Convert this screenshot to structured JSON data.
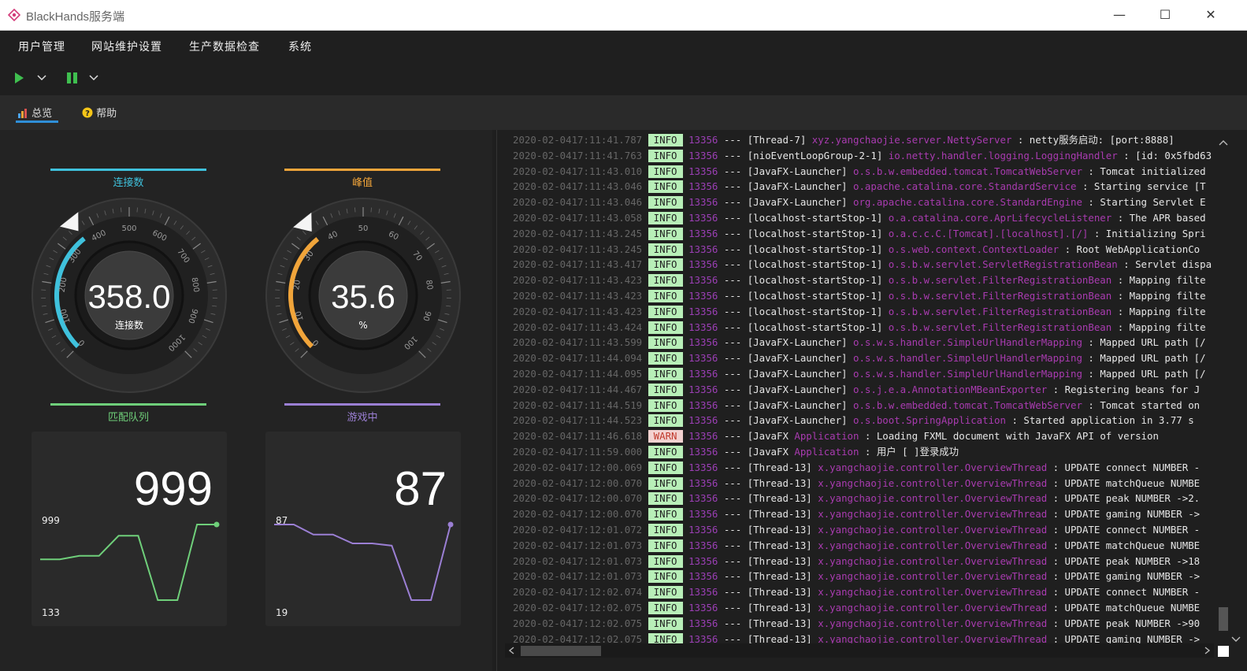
{
  "window": {
    "title": "BlackHands服务端",
    "min": "—",
    "max": "☐",
    "close": "✕"
  },
  "menu": [
    "用户管理",
    "网站维护设置",
    "生产数据检查",
    "系统"
  ],
  "tabs": [
    {
      "label": "总览",
      "icon": "chart-icon"
    },
    {
      "label": "帮助",
      "icon": "help-icon"
    }
  ],
  "colors": {
    "connect": "#3fc1dc",
    "peak": "#f0a43a",
    "match": "#6fcf7a",
    "gaming": "#9b7fd4",
    "accent": "#2f8fd8"
  },
  "gauges": [
    {
      "title": "连接数",
      "value": "358.0",
      "unit": "连接数",
      "min": 0,
      "max": 1000,
      "level": 358,
      "ticks": [
        "0",
        "100",
        "200",
        "300",
        "400",
        "500",
        "600",
        "700",
        "800",
        "900",
        "1000"
      ],
      "color": "#3fc1dc"
    },
    {
      "title": "峰值",
      "value": "35.6",
      "unit": "%",
      "min": 0,
      "max": 100,
      "level": 35.6,
      "ticks": [
        "0",
        "10",
        "20",
        "30",
        "40",
        "50",
        "60",
        "70",
        "80",
        "90",
        "100"
      ],
      "color": "#f0a43a"
    }
  ],
  "cards": [
    {
      "title": "匹配队列",
      "value": "999",
      "max_label": "999",
      "min_label": "133",
      "color": "#6fcf7a",
      "series": [
        600,
        600,
        640,
        640,
        870,
        870,
        133,
        133,
        999,
        999
      ]
    },
    {
      "title": "游戏中",
      "value": "87",
      "max_label": "87",
      "min_label": "19",
      "color": "#9b7fd4",
      "series": [
        87,
        87,
        78,
        78,
        70,
        70,
        68,
        19,
        19,
        87
      ]
    }
  ],
  "log": [
    {
      "ts": "2020-02-0417:11:41.787",
      "lvl": "INFO",
      "pid": "13356",
      "thread": "[Thread-7]",
      "logger": "xyz.yangchaojie.server.NettyServer",
      "msg": ": netty服务启动: [port:8888]"
    },
    {
      "ts": "2020-02-0417:11:41.763",
      "lvl": "INFO",
      "pid": "13356",
      "thread": "[nioEventLoopGroup-2-1]",
      "logger": "io.netty.handler.logging.LoggingHandler",
      "msg": ": [id: 0x5fbd63"
    },
    {
      "ts": "2020-02-0417:11:43.010",
      "lvl": "INFO",
      "pid": "13356",
      "thread": "[JavaFX-Launcher]",
      "logger": "o.s.b.w.embedded.tomcat.TomcatWebServer",
      "msg": ": Tomcat initialized"
    },
    {
      "ts": "2020-02-0417:11:43.046",
      "lvl": "INFO",
      "pid": "13356",
      "thread": "[JavaFX-Launcher]",
      "logger": "o.apache.catalina.core.StandardService",
      "msg": ": Starting service [T"
    },
    {
      "ts": "2020-02-0417:11:43.046",
      "lvl": "INFO",
      "pid": "13356",
      "thread": "[JavaFX-Launcher]",
      "logger": "org.apache.catalina.core.StandardEngine",
      "msg": ": Starting Servlet E"
    },
    {
      "ts": "2020-02-0417:11:43.058",
      "lvl": "INFO",
      "pid": "13356",
      "thread": "[localhost-startStop-1]",
      "logger": "o.a.catalina.core.AprLifecycleListener",
      "msg": ": The APR based"
    },
    {
      "ts": "2020-02-0417:11:43.245",
      "lvl": "INFO",
      "pid": "13356",
      "thread": "[localhost-startStop-1]",
      "logger": "o.a.c.c.C.[Tomcat].[localhost].[/]",
      "msg": ": Initializing Spri"
    },
    {
      "ts": "2020-02-0417:11:43.245",
      "lvl": "INFO",
      "pid": "13356",
      "thread": "[localhost-startStop-1]",
      "logger": "o.s.web.context.ContextLoader",
      "msg": ": Root WebApplicationCo"
    },
    {
      "ts": "2020-02-0417:11:43.417",
      "lvl": "INFO",
      "pid": "13356",
      "thread": "[localhost-startStop-1]",
      "logger": "o.s.b.w.servlet.ServletRegistrationBean",
      "msg": ": Servlet dispa"
    },
    {
      "ts": "2020-02-0417:11:43.423",
      "lvl": "INFO",
      "pid": "13356",
      "thread": "[localhost-startStop-1]",
      "logger": "o.s.b.w.servlet.FilterRegistrationBean",
      "msg": ": Mapping filte"
    },
    {
      "ts": "2020-02-0417:11:43.423",
      "lvl": "INFO",
      "pid": "13356",
      "thread": "[localhost-startStop-1]",
      "logger": "o.s.b.w.servlet.FilterRegistrationBean",
      "msg": ": Mapping filte"
    },
    {
      "ts": "2020-02-0417:11:43.423",
      "lvl": "INFO",
      "pid": "13356",
      "thread": "[localhost-startStop-1]",
      "logger": "o.s.b.w.servlet.FilterRegistrationBean",
      "msg": ": Mapping filte"
    },
    {
      "ts": "2020-02-0417:11:43.424",
      "lvl": "INFO",
      "pid": "13356",
      "thread": "[localhost-startStop-1]",
      "logger": "o.s.b.w.servlet.FilterRegistrationBean",
      "msg": ": Mapping filte"
    },
    {
      "ts": "2020-02-0417:11:43.599",
      "lvl": "INFO",
      "pid": "13356",
      "thread": "[JavaFX-Launcher]",
      "logger": "o.s.w.s.handler.SimpleUrlHandlerMapping",
      "msg": ": Mapped URL path [/"
    },
    {
      "ts": "2020-02-0417:11:44.094",
      "lvl": "INFO",
      "pid": "13356",
      "thread": "[JavaFX-Launcher]",
      "logger": "o.s.w.s.handler.SimpleUrlHandlerMapping",
      "msg": ": Mapped URL path [/"
    },
    {
      "ts": "2020-02-0417:11:44.095",
      "lvl": "INFO",
      "pid": "13356",
      "thread": "[JavaFX-Launcher]",
      "logger": "o.s.w.s.handler.SimpleUrlHandlerMapping",
      "msg": ": Mapped URL path [/"
    },
    {
      "ts": "2020-02-0417:11:44.467",
      "lvl": "INFO",
      "pid": "13356",
      "thread": "[JavaFX-Launcher]",
      "logger": "o.s.j.e.a.AnnotationMBeanExporter",
      "msg": ": Registering beans for J"
    },
    {
      "ts": "2020-02-0417:11:44.519",
      "lvl": "INFO",
      "pid": "13356",
      "thread": "[JavaFX-Launcher]",
      "logger": "o.s.b.w.embedded.tomcat.TomcatWebServer",
      "msg": ": Tomcat started on"
    },
    {
      "ts": "2020-02-0417:11:44.523",
      "lvl": "INFO",
      "pid": "13356",
      "thread": "[JavaFX-Launcher]",
      "logger": "o.s.boot.SpringApplication",
      "msg": ": Started application in 3.77 s"
    },
    {
      "ts": "2020-02-0417:11:46.618",
      "lvl": "WARN",
      "pid": "13356",
      "thread": "[JavaFX",
      "logger": "Application",
      "msg": ": Loading FXML document with JavaFX API of version"
    },
    {
      "ts": "2020-02-0417:11:59.000",
      "lvl": "INFO",
      "pid": "13356",
      "thread": "[JavaFX",
      "logger": "Application",
      "msg": ": 用户 [       ]登录成功"
    },
    {
      "ts": "2020-02-0417:12:00.069",
      "lvl": "INFO",
      "pid": "13356",
      "thread": "[Thread-13]",
      "logger": "x.yangchaojie.controller.OverviewThread",
      "msg": ": UPDATE connect NUMBER -"
    },
    {
      "ts": "2020-02-0417:12:00.070",
      "lvl": "INFO",
      "pid": "13356",
      "thread": "[Thread-13]",
      "logger": "x.yangchaojie.controller.OverviewThread",
      "msg": ": UPDATE matchQueue NUMBE"
    },
    {
      "ts": "2020-02-0417:12:00.070",
      "lvl": "INFO",
      "pid": "13356",
      "thread": "[Thread-13]",
      "logger": "x.yangchaojie.controller.OverviewThread",
      "msg": ": UPDATE peak NUMBER ->2."
    },
    {
      "ts": "2020-02-0417:12:00.070",
      "lvl": "INFO",
      "pid": "13356",
      "thread": "[Thread-13]",
      "logger": "x.yangchaojie.controller.OverviewThread",
      "msg": ": UPDATE gaming NUMBER ->"
    },
    {
      "ts": "2020-02-0417:12:01.072",
      "lvl": "INFO",
      "pid": "13356",
      "thread": "[Thread-13]",
      "logger": "x.yangchaojie.controller.OverviewThread",
      "msg": ": UPDATE connect NUMBER -"
    },
    {
      "ts": "2020-02-0417:12:01.073",
      "lvl": "INFO",
      "pid": "13356",
      "thread": "[Thread-13]",
      "logger": "x.yangchaojie.controller.OverviewThread",
      "msg": ": UPDATE matchQueue NUMBE"
    },
    {
      "ts": "2020-02-0417:12:01.073",
      "lvl": "INFO",
      "pid": "13356",
      "thread": "[Thread-13]",
      "logger": "x.yangchaojie.controller.OverviewThread",
      "msg": ": UPDATE peak NUMBER ->18"
    },
    {
      "ts": "2020-02-0417:12:01.073",
      "lvl": "INFO",
      "pid": "13356",
      "thread": "[Thread-13]",
      "logger": "x.yangchaojie.controller.OverviewThread",
      "msg": ": UPDATE gaming NUMBER ->"
    },
    {
      "ts": "2020-02-0417:12:02.074",
      "lvl": "INFO",
      "pid": "13356",
      "thread": "[Thread-13]",
      "logger": "x.yangchaojie.controller.OverviewThread",
      "msg": ": UPDATE connect NUMBER -"
    },
    {
      "ts": "2020-02-0417:12:02.075",
      "lvl": "INFO",
      "pid": "13356",
      "thread": "[Thread-13]",
      "logger": "x.yangchaojie.controller.OverviewThread",
      "msg": ": UPDATE matchQueue NUMBE"
    },
    {
      "ts": "2020-02-0417:12:02.075",
      "lvl": "INFO",
      "pid": "13356",
      "thread": "[Thread-13]",
      "logger": "x.yangchaojie.controller.OverviewThread",
      "msg": ": UPDATE peak NUMBER ->90"
    },
    {
      "ts": "2020-02-0417:12:02.075",
      "lvl": "INFO",
      "pid": "13356",
      "thread": "[Thread-13]",
      "logger": "x.yangchaojie.controller.OverviewThread",
      "msg": ": UPDATE gaming NUMBER ->"
    }
  ]
}
